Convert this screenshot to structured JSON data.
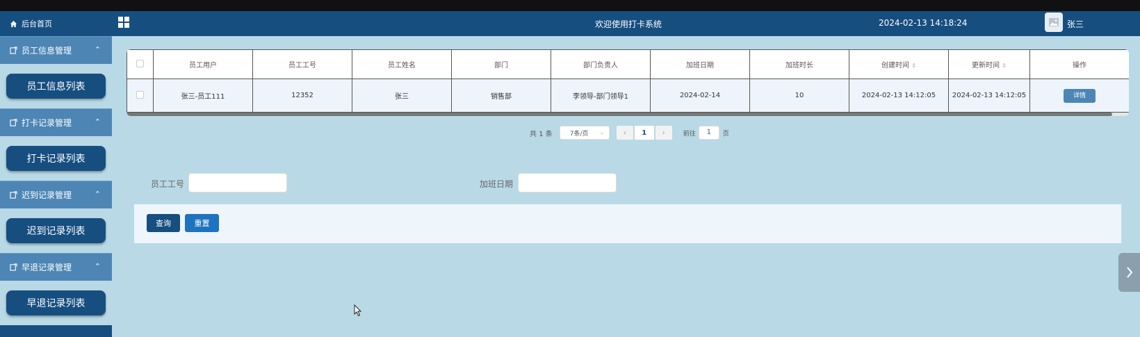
{
  "sidebar": {
    "home_label": "后台首页",
    "groups": [
      {
        "label": "员工信息管理",
        "item": "员工信息列表"
      },
      {
        "label": "打卡记录管理",
        "item": "打卡记录列表"
      },
      {
        "label": "迟到记录管理",
        "item": "迟到记录列表"
      },
      {
        "label": "早退记录管理",
        "item": "早退记录列表"
      }
    ]
  },
  "header": {
    "title": "欢迎使用打卡系统",
    "datetime": "2024-02-13 14:18:24",
    "username": "张三"
  },
  "table": {
    "columns": [
      "员工用户",
      "员工工号",
      "员工姓名",
      "部门",
      "部门负责人",
      "加班日期",
      "加班时长",
      "创建时间",
      "更新时间",
      "操作"
    ],
    "sort_icon": "⇕",
    "row": {
      "user": "张三-员工111",
      "emp_no": "12352",
      "name": "张三",
      "dept": "销售部",
      "leader": "李领导-部门领导1",
      "ot_date": "2024-02-14",
      "ot_hours": "10",
      "created": "2024-02-13 14:12:05",
      "updated": "2024-02-13 14:12:05",
      "action": "详情"
    }
  },
  "pagination": {
    "total": "共 1 条",
    "page_size": "7条/页",
    "current_page": "1",
    "goto_label": "前往",
    "goto_value": "1",
    "page_unit": "页"
  },
  "search": {
    "emp_no_label": "员工工号",
    "emp_no_value": "",
    "ot_date_label": "加班日期",
    "ot_date_value": "",
    "query_button": "查询",
    "reset_button": "重置"
  },
  "colors": {
    "primary": "#174e80",
    "secondary": "#4d86b5",
    "background": "#b9d9e6",
    "reset": "#1e73be"
  }
}
